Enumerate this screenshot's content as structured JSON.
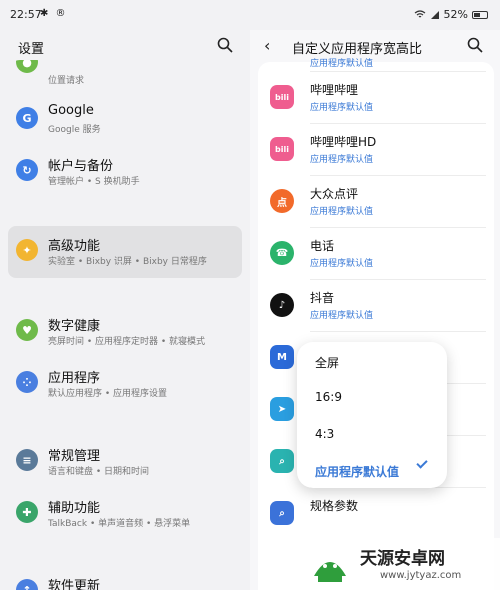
{
  "status_bar": {
    "time": "22:57",
    "left_icons": "✱ ®",
    "battery": "52%"
  },
  "left": {
    "title": "设置",
    "top_partial_subtitle": "位置请求",
    "items": [
      {
        "title": "Google",
        "subtitle": "Google 服务",
        "color": "#3f7fe6",
        "icon": "google-icon",
        "glyph": "G"
      },
      {
        "title": "帐户与备份",
        "subtitle": "管理帐户 • S 换机助手",
        "color": "#3f7fe6",
        "icon": "sync-icon",
        "glyph": "↻"
      },
      {
        "title": "高级功能",
        "subtitle": "实验室 • Bixby 识屏 • Bixby 日常程序",
        "color": "#f2b531",
        "icon": "gear-plus-icon",
        "glyph": "✦"
      },
      {
        "title": "数字健康",
        "subtitle": "亮屏时间 • 应用程序定时器 • 就寝模式",
        "color": "#6fba4a",
        "icon": "wellbeing-icon",
        "glyph": "♥"
      },
      {
        "title": "应用程序",
        "subtitle": "默认应用程序 • 应用程序设置",
        "color": "#4a7fe0",
        "icon": "apps-grid-icon",
        "glyph": "⁘"
      },
      {
        "title": "常规管理",
        "subtitle": "语言和键盘 • 日期和时间",
        "color": "#5a7a99",
        "icon": "sliders-icon",
        "glyph": "≡"
      },
      {
        "title": "辅助功能",
        "subtitle": "TalkBack • 单声道音频 • 悬浮菜单",
        "color": "#3aa56a",
        "icon": "accessibility-icon",
        "glyph": "✚"
      },
      {
        "title": "软件更新",
        "subtitle": "",
        "color": "#4a7fe0",
        "icon": "update-icon",
        "glyph": "↑"
      }
    ]
  },
  "right": {
    "title": "自定义应用程序宽高比",
    "top_partial_subtitle": "应用程序默认值",
    "apps": [
      {
        "name": "哔哩哔哩",
        "subtitle": "应用程序默认值",
        "color": "#ef5d8f",
        "icon": "bilibili-icon",
        "glyph": "bili"
      },
      {
        "name": "哔哩哔哩HD",
        "subtitle": "应用程序默认值",
        "color": "#ef5d8f",
        "icon": "bilibili-hd-icon",
        "glyph": "bili"
      },
      {
        "name": "大众点评",
        "subtitle": "应用程序默认值",
        "color": "#f26a2a",
        "icon": "dianping-icon",
        "glyph": "点"
      },
      {
        "name": "电话",
        "subtitle": "应用程序默认值",
        "color": "#2bb36b",
        "icon": "phone-icon",
        "glyph": "☎"
      },
      {
        "name": "抖音",
        "subtitle": "应用程序默认值",
        "color": "#111111",
        "icon": "douyin-icon",
        "glyph": "♪"
      },
      {
        "name": "",
        "subtitle": "",
        "color": "#2b6ad8",
        "icon": "m-app-icon",
        "glyph": "M"
      },
      {
        "name": "",
        "subtitle": "",
        "color": "#2a9ee0",
        "icon": "send-app-icon",
        "glyph": "➤"
      },
      {
        "name": "",
        "subtitle": "",
        "color": "#2ab3b0",
        "icon": "scan-app-icon",
        "glyph": "⌕"
      },
      {
        "name": "规格参数",
        "subtitle": "",
        "color": "#3b72d9",
        "icon": "spec-icon",
        "glyph": "⌕"
      }
    ]
  },
  "popup": {
    "options": [
      "全屏",
      "16:9",
      "4:3",
      "应用程序默认值"
    ],
    "selected": "应用程序默认值"
  },
  "watermark": {
    "title": "天源安卓网",
    "url": "www.jytyaz.com"
  }
}
